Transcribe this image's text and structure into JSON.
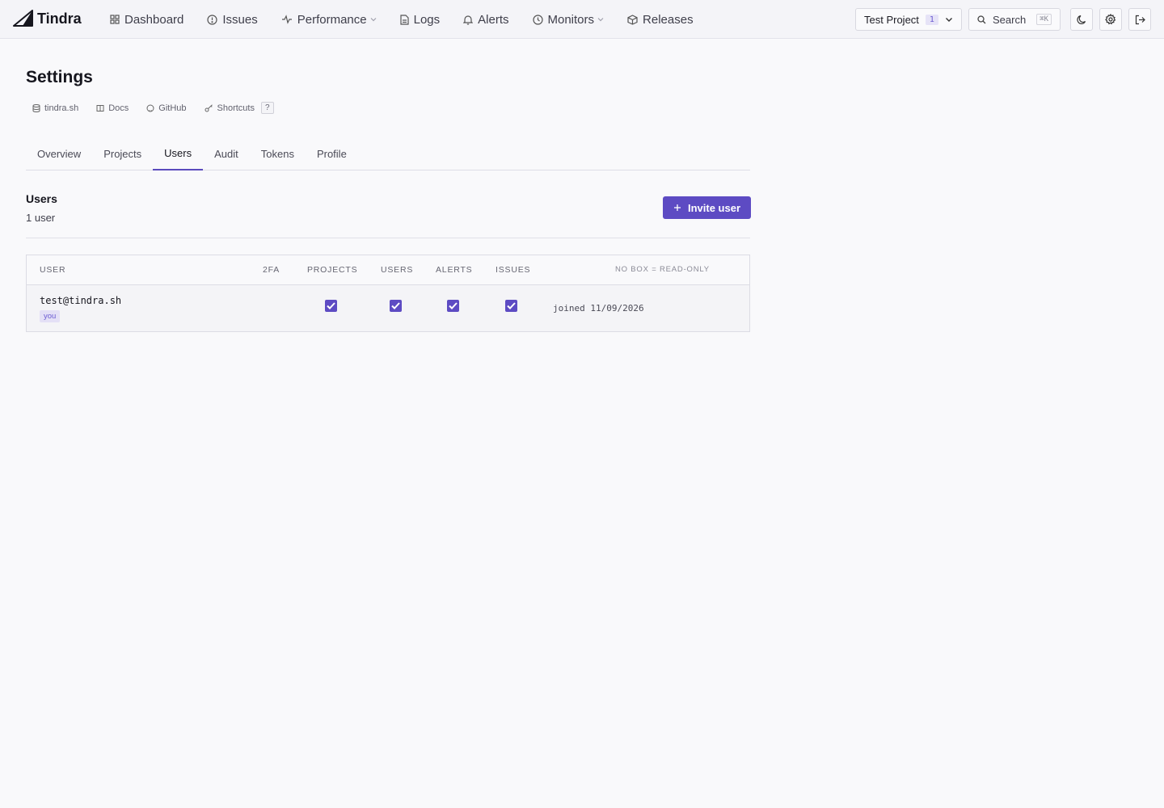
{
  "app": {
    "name": "Tindra"
  },
  "nav": {
    "items": [
      {
        "label": "Dashboard",
        "icon": "grid-icon"
      },
      {
        "label": "Issues",
        "icon": "alert-circle-icon"
      },
      {
        "label": "Performance",
        "icon": "activity-icon",
        "has_dropdown": true
      },
      {
        "label": "Logs",
        "icon": "file-text-icon"
      },
      {
        "label": "Alerts",
        "icon": "bell-icon"
      },
      {
        "label": "Monitors",
        "icon": "clock-icon",
        "has_dropdown": true
      },
      {
        "label": "Releases",
        "icon": "package-icon"
      }
    ]
  },
  "toolbar": {
    "project": {
      "name": "Test Project",
      "count": "1"
    },
    "search": {
      "label": "Search",
      "shortcut": "⌘K"
    }
  },
  "page": {
    "title": "Settings",
    "quicklinks": [
      {
        "label": "tindra.sh",
        "icon": "database-icon"
      },
      {
        "label": "Docs",
        "icon": "book-icon"
      },
      {
        "label": "GitHub",
        "icon": "github-icon"
      },
      {
        "label": "Shortcuts",
        "icon": "key-icon",
        "kbd": "?"
      }
    ],
    "tabs": [
      "Overview",
      "Projects",
      "Users",
      "Audit",
      "Tokens",
      "Profile"
    ],
    "active_tab": "Users"
  },
  "users": {
    "title": "Users",
    "subtitle": "1 user",
    "invite_label": "Invite user",
    "columns": {
      "user": "USER",
      "twofa": "2FA",
      "projects": "PROJECTS",
      "users": "USERS",
      "alerts": "ALERTS",
      "issues": "ISSUES",
      "note": "NO BOX = READ-ONLY"
    },
    "rows": [
      {
        "email": "test@tindra.sh",
        "badge": "you",
        "projects": true,
        "users": true,
        "alerts": true,
        "issues": true,
        "joined": "joined 11/09/2026"
      }
    ]
  },
  "colors": {
    "accent": "#5d4bc3",
    "background": "#f9f9fb",
    "topbar": "#f4f4f8"
  }
}
